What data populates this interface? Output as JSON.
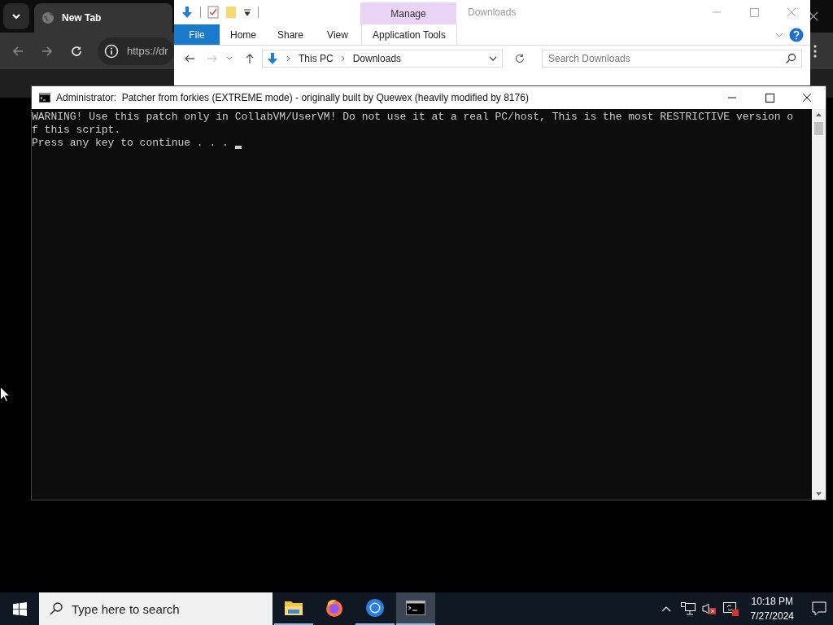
{
  "browser": {
    "tab_title": "New Tab",
    "address": "https://dr"
  },
  "explorer": {
    "title": "Downloads",
    "context_group": "Manage",
    "ribbon": [
      {
        "label": "File",
        "kind": "file"
      },
      {
        "label": "Home",
        "kind": "tab"
      },
      {
        "label": "Share",
        "kind": "tab"
      },
      {
        "label": "View",
        "kind": "tab"
      },
      {
        "label": "Application Tools",
        "kind": "context"
      }
    ],
    "breadcrumb": [
      "This PC",
      "Downloads"
    ],
    "search": {
      "placeholder": "Search Downloads"
    }
  },
  "console": {
    "title": "Administrator:  Patcher from forkies (EXTREME mode) - originally built by Quewex (heavily modified by 8176)",
    "lines": [
      "WARNING! Use this patch only in CollabVM/UserVM! Do not use it at a real PC/host, This is the most RESTRICTIVE version o",
      "f this script.",
      "Press any key to continue . . ."
    ]
  },
  "taskbar": {
    "search": {
      "placeholder": "Type here to search"
    },
    "apps": [
      {
        "kind": "folder",
        "running": true,
        "selected": false
      },
      {
        "kind": "firefox",
        "running": false,
        "selected": false
      },
      {
        "kind": "chrome",
        "running": true,
        "selected": false
      },
      {
        "kind": "terminal",
        "running": true,
        "selected": true
      }
    ],
    "time": "10:18 PM",
    "date": "7/27/2024"
  }
}
